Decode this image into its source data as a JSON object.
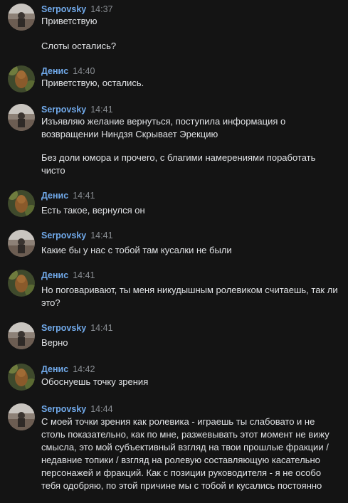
{
  "messages": [
    {
      "author": "Serpovsky",
      "time": "14:37",
      "avatar": "serpovsky",
      "paragraphs": [
        "Приветствую",
        "Слоты остались?"
      ]
    },
    {
      "author": "Денис",
      "time": "14:40",
      "avatar": "denis",
      "paragraphs": [
        "Приветствую, остались."
      ]
    },
    {
      "author": "Serpovsky",
      "time": "14:41",
      "avatar": "serpovsky",
      "paragraphs": [
        "Изъявляю желание вернуться, поступила информация о возвращении Ниндзя Скрывает Эрекцию",
        "Без доли юмора и прочего, с благими намерениями поработать чисто"
      ]
    },
    {
      "author": "Денис",
      "time": "14:41",
      "avatar": "denis",
      "paragraphs": [
        "Есть такое, вернулся он"
      ]
    },
    {
      "author": "Serpovsky",
      "time": "14:41",
      "avatar": "serpovsky",
      "paragraphs": [
        "Какие бы у нас с тобой там кусалки не были"
      ]
    },
    {
      "author": "Денис",
      "time": "14:41",
      "avatar": "denis",
      "paragraphs": [
        "Но поговаривают, ты меня никудышным ролевиком считаешь, так ли это?"
      ]
    },
    {
      "author": "Serpovsky",
      "time": "14:41",
      "avatar": "serpovsky",
      "paragraphs": [
        "Верно"
      ]
    },
    {
      "author": "Денис",
      "time": "14:42",
      "avatar": "denis",
      "paragraphs": [
        "Обоснуешь точку зрения"
      ]
    },
    {
      "author": "Serpovsky",
      "time": "14:44",
      "avatar": "serpovsky",
      "paragraphs": [
        "С моей точки зрения как ролевика - играешь ты слабовато и не столь показательно, как по мне, разжевывать этот момент не вижу смысла, это мой субъективный взгляд на твои прошлые фракции / недавние топики / взгляд на ролевую составляющую касательно персонажей и фракций. Как с позиции руководителя - я не особо тебя одобряю, по этой причине мы с тобой и кусались постоянно"
      ]
    }
  ]
}
